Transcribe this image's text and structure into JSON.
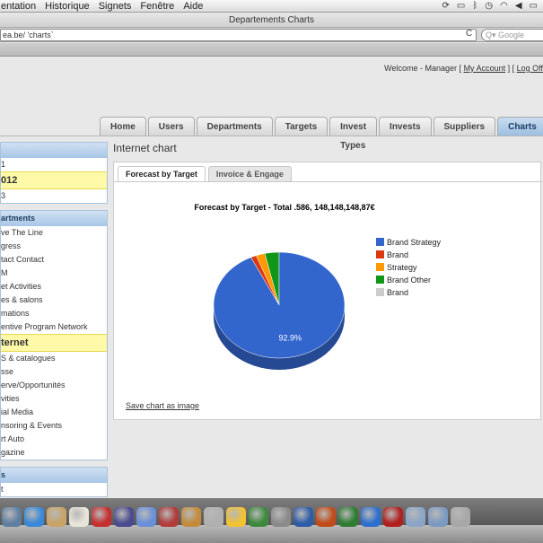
{
  "menubar": {
    "items": [
      "entation",
      "Historique",
      "Signets",
      "Fenêtre",
      "Aide"
    ]
  },
  "window": {
    "title": "Departements Charts"
  },
  "address": {
    "url": "ea.be/ 'charts`",
    "search_placeholder": "Google"
  },
  "header": {
    "welcome_prefix": "Welcome - Manager [",
    "my_account": "My Account",
    "separator": "] [",
    "logout": "Log Off"
  },
  "nav": {
    "tabs": [
      "Home",
      "Users",
      "Departments",
      "Targets",
      "Invest Types",
      "Invests",
      "Suppliers",
      "Charts"
    ],
    "active": "Charts"
  },
  "sidebar": {
    "years": {
      "items": [
        "1",
        "012",
        "3"
      ],
      "selected_index": 1
    },
    "departments": {
      "title": "artments",
      "items": [
        "ve The Line",
        "gress",
        "tact Contact",
        "M",
        "et Activities",
        "es & salons",
        "mations",
        "entive Program Network",
        "ternet",
        "S & catalogues",
        "sse",
        "erve/Opportunités",
        "vities",
        "ial Media",
        "nsoring & Events",
        "rt Auto",
        "gazine"
      ],
      "selected_index": 8
    },
    "bottom": {
      "title": "s",
      "items": [
        "t"
      ]
    }
  },
  "main": {
    "title": "Internet chart",
    "subtabs": [
      "Forecast by Target",
      "Invoice & Engage"
    ],
    "active_subtab": "Forecast by Target",
    "save_link": "Save chart as image"
  },
  "chart_data": {
    "type": "pie",
    "title": "Forecast by Target - Total .586, 148,148,148,87€",
    "slices": [
      {
        "label": "Brand Strategy",
        "value": 92.9,
        "color": "#3366cc"
      },
      {
        "label": "Brand",
        "value": 1.4,
        "color": "#dc3912"
      },
      {
        "label": "Strategy",
        "value": 2.2,
        "color": "#ff9900"
      },
      {
        "label": "Brand  Other",
        "value": 3.5,
        "color": "#109618"
      },
      {
        "label": "Brand",
        "value": 0.0,
        "color": "#cccccc"
      }
    ],
    "data_label": "92.9%",
    "legend_position": "right",
    "3d": true
  },
  "dock": {
    "icons": [
      "finder-icon",
      "safari-icon",
      "preview-icon",
      "calendar-icon",
      "acrobat-icon",
      "imovie-icon",
      "itunes-icon",
      "photobooth-icon",
      "iphoto-icon",
      "mailbox-icon",
      "adium-icon",
      "timemachine-icon",
      "systemprefs-icon",
      "word-icon",
      "powerpoint-icon",
      "excel-icon",
      "appstore-icon",
      "flash-icon",
      "folder-icon",
      "downloads-icon",
      "trash-icon"
    ],
    "colors": [
      "#5f7fa0",
      "#3a89d8",
      "#c9a466",
      "#e9e4d9",
      "#c72f2f",
      "#4b4b8f",
      "#6a8fd8",
      "#b23b3b",
      "#c38b3a",
      "#b0b0b0",
      "#f1c232",
      "#3d8a3d",
      "#8a8a8a",
      "#2e5ca8",
      "#c24b1a",
      "#2e7d32",
      "#2d6fcf",
      "#b21f1f",
      "#8aa5c7",
      "#7c9ac1",
      "#a7a7a7"
    ]
  }
}
